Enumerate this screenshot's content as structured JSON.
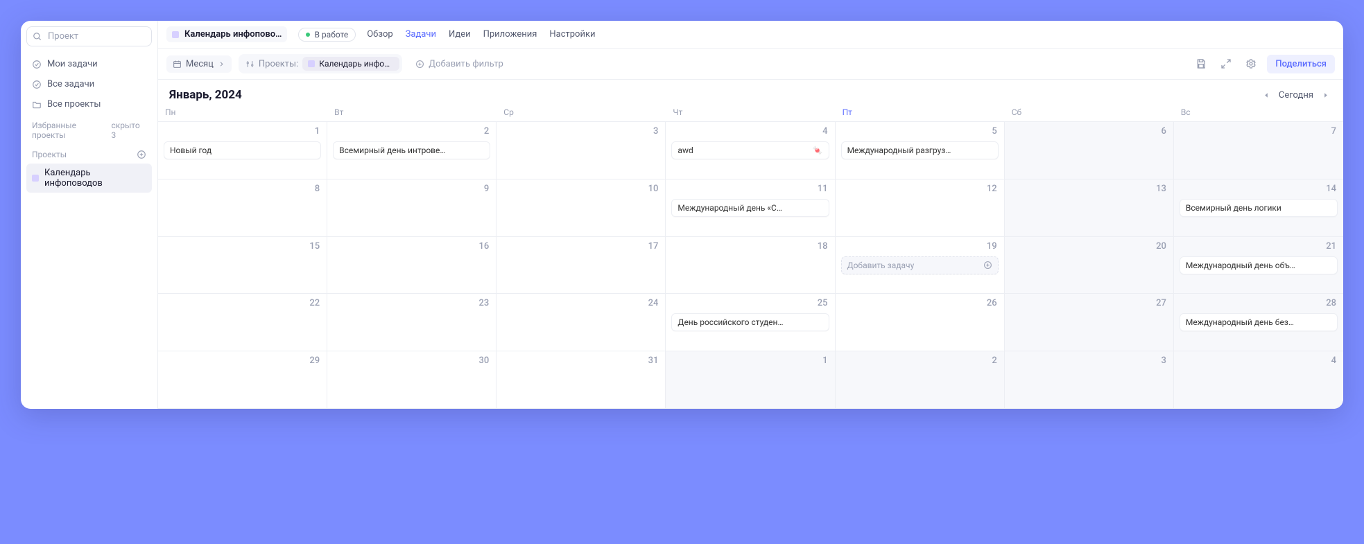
{
  "sidebar": {
    "search_placeholder": "Проект",
    "nav": [
      {
        "label": "Мои задачи"
      },
      {
        "label": "Все задачи"
      },
      {
        "label": "Все проекты"
      }
    ],
    "fav_header": "Избранные проекты",
    "fav_hidden": "скрыто 3",
    "projects_header": "Проекты",
    "project_item": "Календарь инфоповодов"
  },
  "header": {
    "crumb": "Календарь инфопово…",
    "status": "В работе",
    "tabs": [
      "Обзор",
      "Задачи",
      "Идеи",
      "Приложения",
      "Настройки"
    ]
  },
  "toolbar": {
    "view": "Месяц",
    "filter_label": "Проекты:",
    "chip": "Календарь инфопов…",
    "add_filter": "Добавить фильтр",
    "share": "Поделиться"
  },
  "calendar": {
    "title": "Январь, 2024",
    "today_label": "Сегодня",
    "weekdays": [
      "Пн",
      "Вт",
      "Ср",
      "Чт",
      "Пт",
      "Сб",
      "Вс"
    ],
    "today_weekday_index": 4,
    "add_task_placeholder": "Добавить задачу",
    "weeks": [
      [
        {
          "n": "1",
          "events": [
            {
              "t": "Новый год"
            }
          ]
        },
        {
          "n": "2",
          "events": [
            {
              "t": "Всемирный день интрове…"
            }
          ]
        },
        {
          "n": "3"
        },
        {
          "n": "4",
          "events": [
            {
              "t": "awd",
              "emoji": "🍬"
            }
          ]
        },
        {
          "n": "5",
          "events": [
            {
              "t": "Международный разгруз…"
            }
          ]
        },
        {
          "n": "6",
          "weekend": true
        },
        {
          "n": "7",
          "weekend": true
        }
      ],
      [
        {
          "n": "8"
        },
        {
          "n": "9"
        },
        {
          "n": "10"
        },
        {
          "n": "11",
          "events": [
            {
              "t": "Международный день «С…"
            }
          ]
        },
        {
          "n": "12"
        },
        {
          "n": "13",
          "weekend": true
        },
        {
          "n": "14",
          "weekend": true,
          "events": [
            {
              "t": "Всемирный день логики"
            }
          ]
        }
      ],
      [
        {
          "n": "15"
        },
        {
          "n": "16"
        },
        {
          "n": "17"
        },
        {
          "n": "18"
        },
        {
          "n": "19",
          "ghost": true
        },
        {
          "n": "20",
          "weekend": true
        },
        {
          "n": "21",
          "weekend": true,
          "events": [
            {
              "t": "Международный день объ…"
            }
          ]
        }
      ],
      [
        {
          "n": "22"
        },
        {
          "n": "23"
        },
        {
          "n": "24"
        },
        {
          "n": "25",
          "events": [
            {
              "t": "День российского студен…"
            }
          ]
        },
        {
          "n": "26"
        },
        {
          "n": "27",
          "weekend": true
        },
        {
          "n": "28",
          "weekend": true,
          "events": [
            {
              "t": "Международный день без…"
            }
          ]
        }
      ],
      [
        {
          "n": "29"
        },
        {
          "n": "30"
        },
        {
          "n": "31"
        },
        {
          "n": "1",
          "other": true
        },
        {
          "n": "2",
          "other": true
        },
        {
          "n": "3",
          "other": true,
          "weekend": true
        },
        {
          "n": "4",
          "other": true,
          "weekend": true
        }
      ]
    ]
  }
}
